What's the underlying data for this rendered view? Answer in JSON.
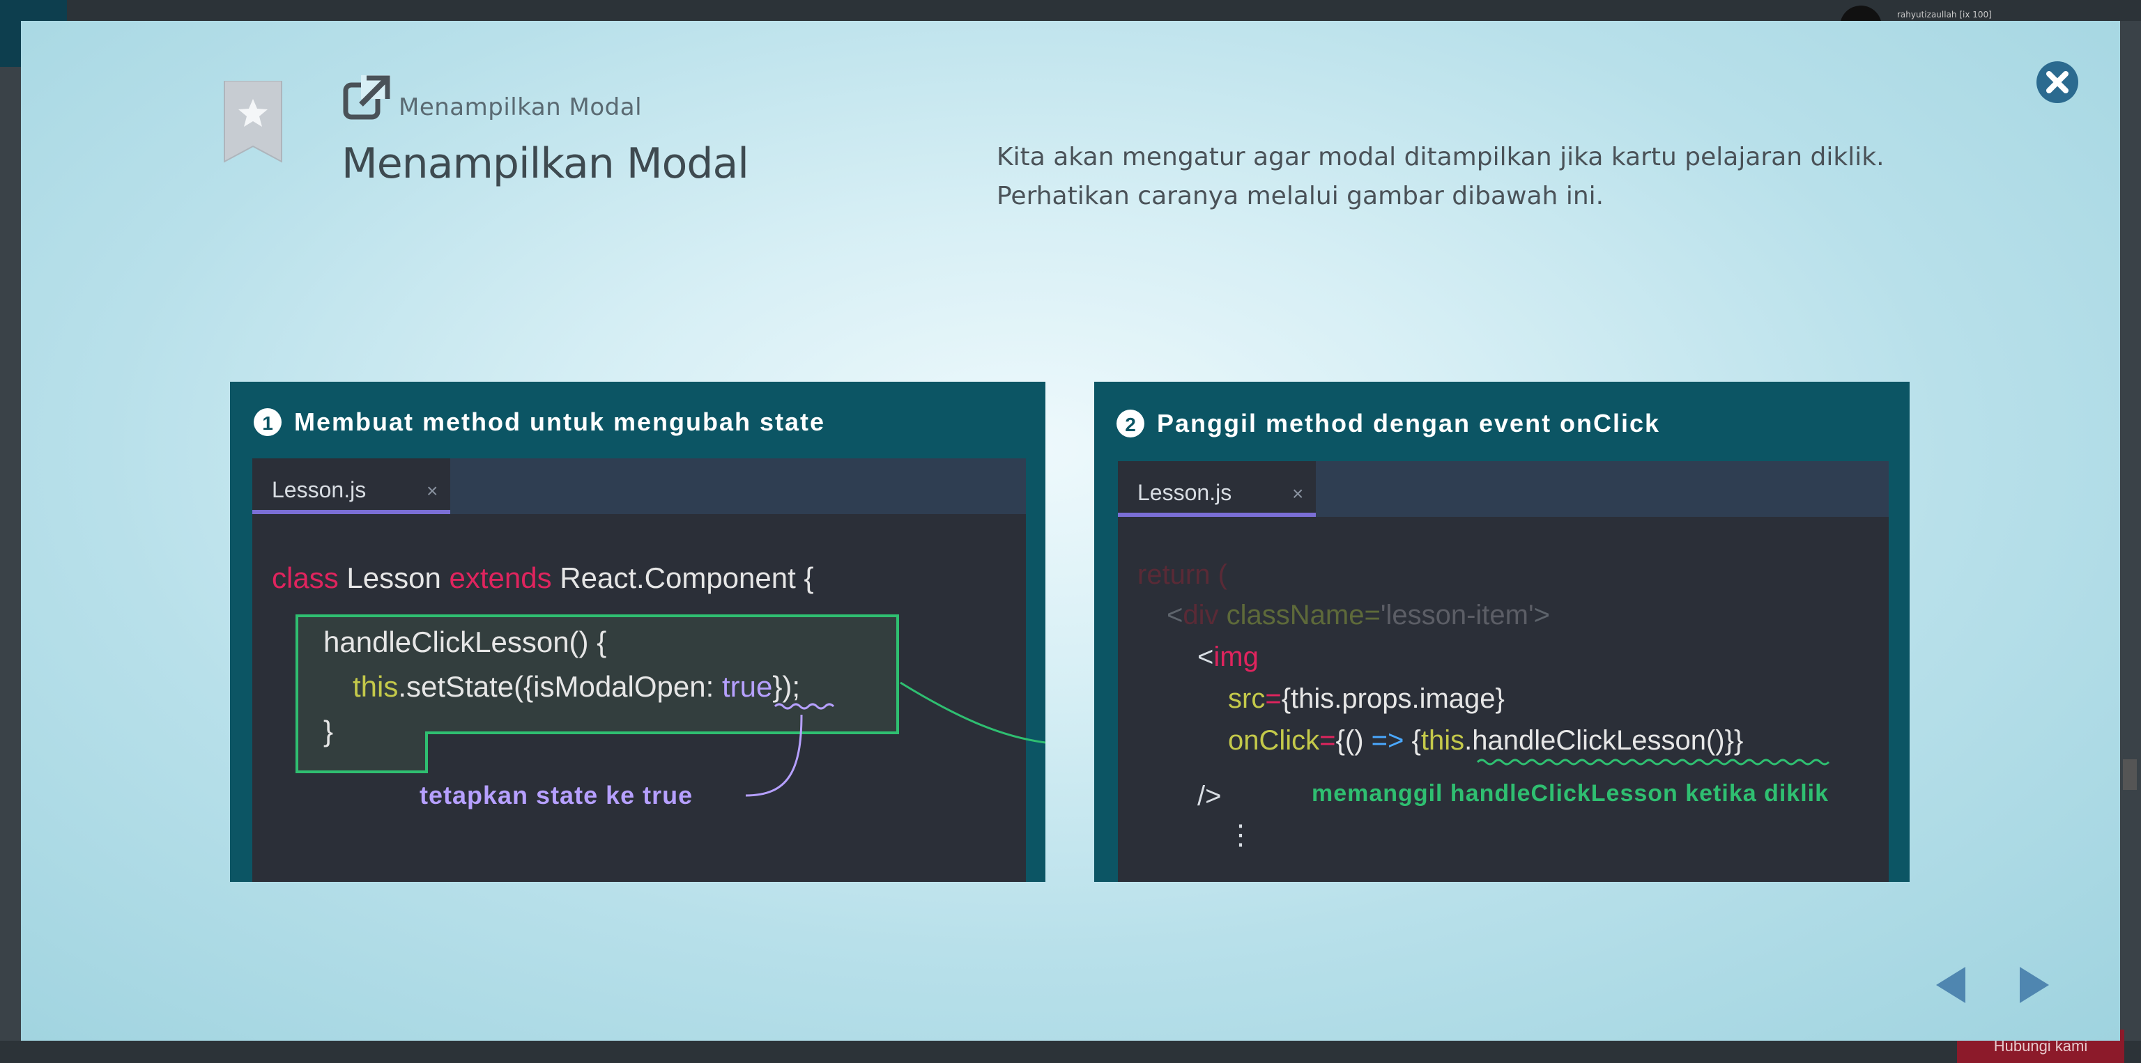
{
  "background": {
    "username": "rahyutizaullah [ix 100]",
    "bottom_button": "Hubungi kami"
  },
  "modal": {
    "breadcrumb": "Menampilkan Modal",
    "title": "Menampilkan Modal",
    "description_line1": "Kita akan mengatur agar modal ditampilkan jika kartu pelajaran diklik.",
    "description_line2": "Perhatikan caranya melalui gambar dibawah ini.",
    "icons": {
      "bookmark": "bookmark-star-icon",
      "external": "external-link-icon",
      "close": "close-icon",
      "prev": "triangle-left-icon",
      "next": "triangle-right-icon"
    },
    "colors": {
      "panel": "#0c5564",
      "editor": "#2b2f38",
      "keyword": "#e0245e",
      "green": "#2fbf71",
      "purple": "#b6a0ff"
    }
  },
  "figure": {
    "panel1": {
      "number": "1",
      "heading": "Membuat method untuk mengubah state",
      "tab": "Lesson.js",
      "tab_close": "×",
      "line1_kw1": "class",
      "line1_name": "Lesson",
      "line1_kw2": "extends",
      "line1_rest": "React.Component {",
      "line2": "handleClickLesson() {",
      "line3_this": "this",
      "line3_mid": ".setState({isModalOpen: ",
      "line3_true": "true",
      "line3_end": "});",
      "line4": "}",
      "annotation": "tetapkan state ke true"
    },
    "panel2": {
      "number": "2",
      "heading": "Panggil method dengan event onClick",
      "tab": "Lesson.js",
      "tab_close": "×",
      "l1": "return (",
      "l2_a": "<",
      "l2_b": "div",
      "l2_c": " className=",
      "l2_d": "'lesson-item'",
      "l2_e": ">",
      "l3_a": "<",
      "l3_b": "img",
      "l4_a": "src",
      "l4_b": "=",
      "l4_c": "{this.props.image}",
      "l5_a": "onClick",
      "l5_b": "=",
      "l5_c": "{() ",
      "l5_d": "=>",
      "l5_e": " {",
      "l5_f": "this",
      "l5_g": ".handleClickLesson()}}",
      "l6": "/>",
      "l7": "⋮",
      "annotation": "memanggil handleClickLesson ketika diklik"
    }
  }
}
